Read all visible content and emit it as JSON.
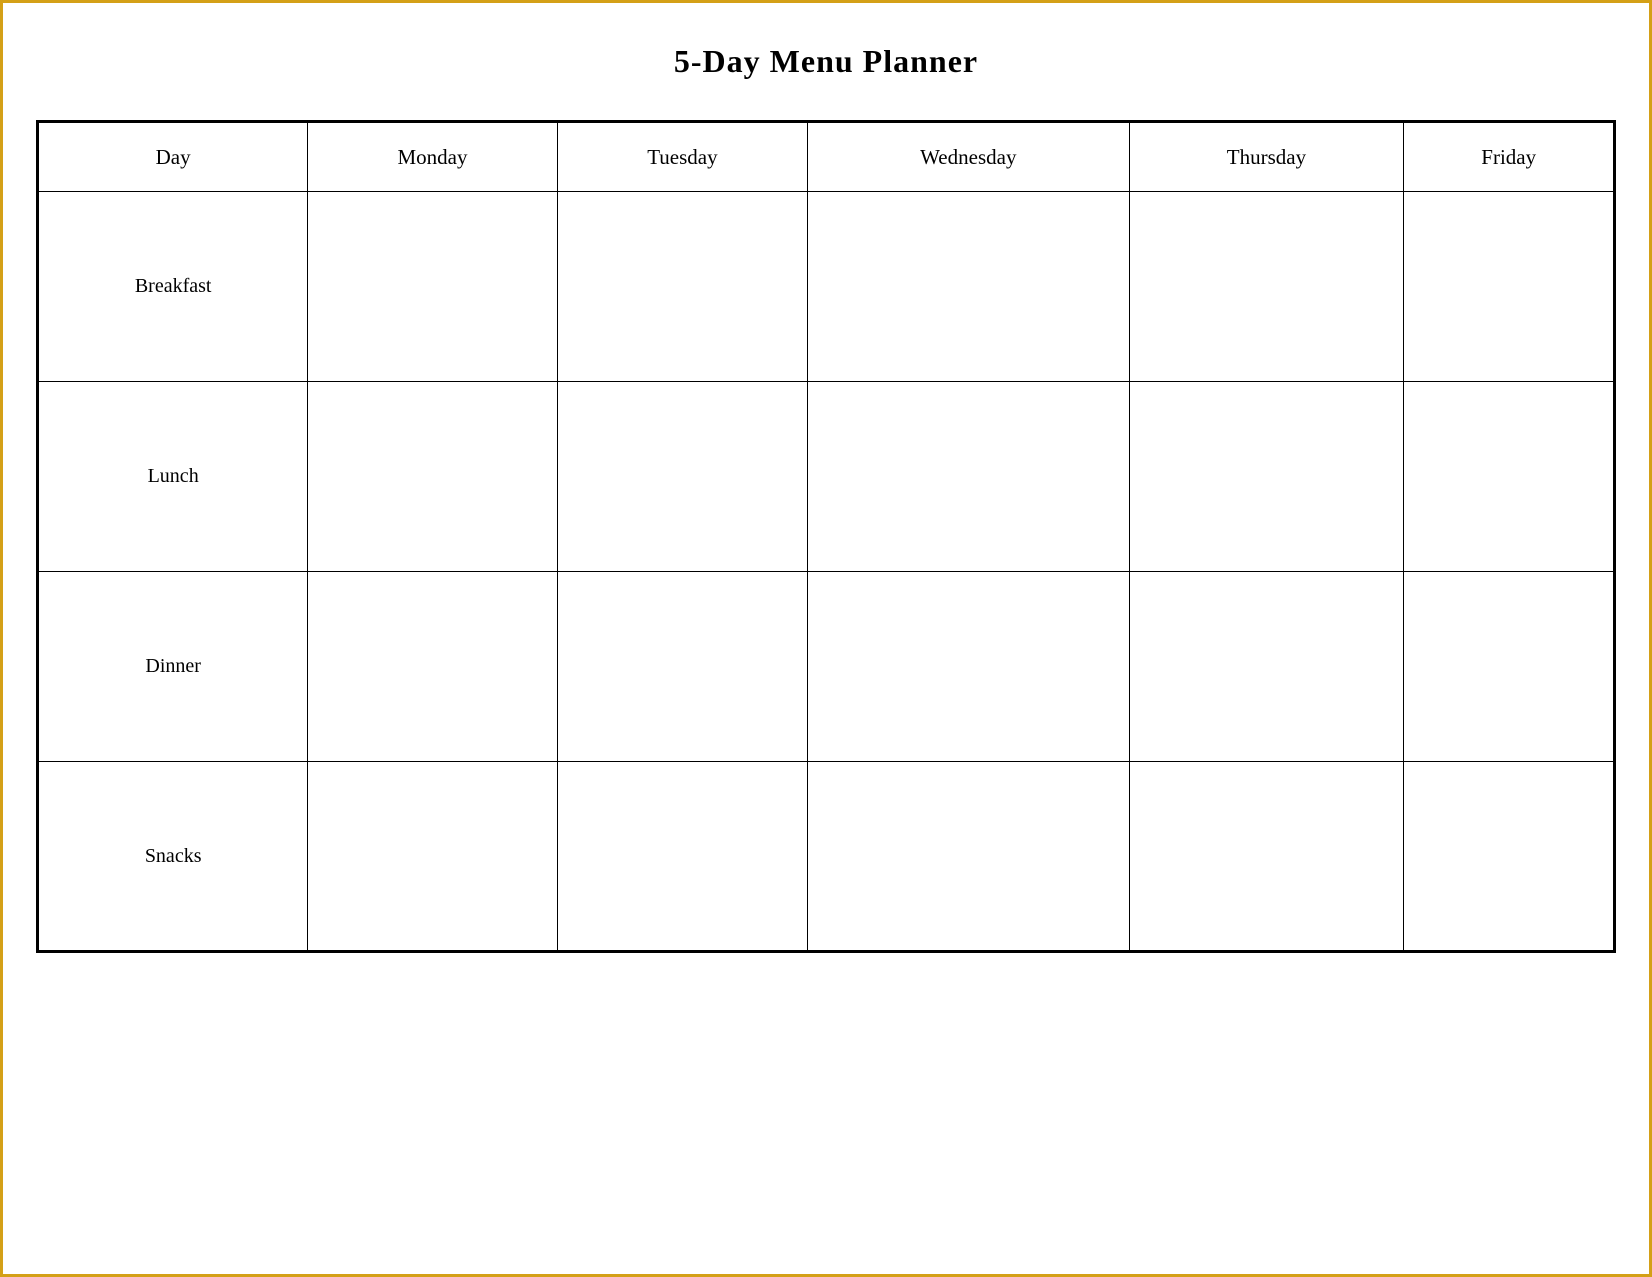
{
  "title": "5-Day Menu Planner",
  "headers": {
    "col0": "Day",
    "col1": "Monday",
    "col2": "Tuesday",
    "col3": "Wednesday",
    "col4": "Thursday",
    "col5": "Friday"
  },
  "rows": [
    {
      "label": "Breakfast"
    },
    {
      "label": "Lunch"
    },
    {
      "label": "Dinner"
    },
    {
      "label": "Snacks"
    }
  ]
}
